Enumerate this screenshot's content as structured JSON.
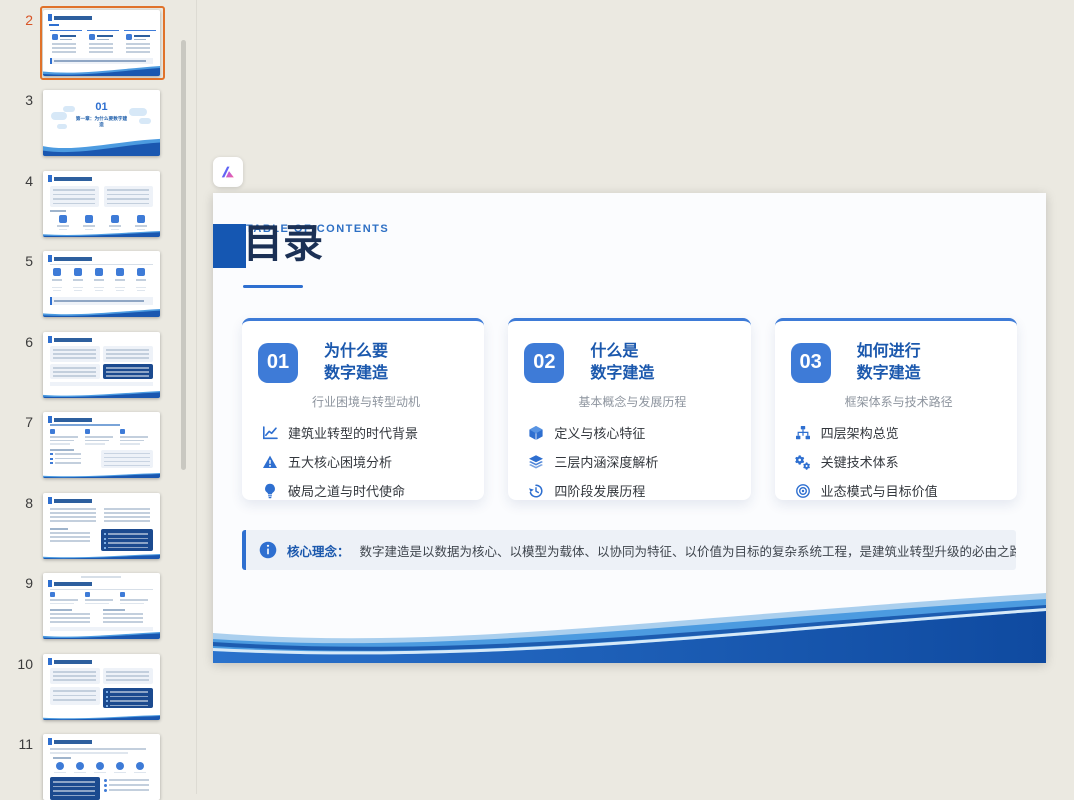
{
  "colors": {
    "accent_blue": "#2E6FD0",
    "badge_blue": "#3E7BD7",
    "title_navy": "#1B3055",
    "selection_orange": "#E0722A",
    "background": "#EBE9E1"
  },
  "sidebar": {
    "thumbnails": [
      {
        "number": "2",
        "selected": true,
        "layout": "toc"
      },
      {
        "number": "3",
        "selected": false,
        "layout": "cover",
        "cover_number": "01",
        "cover_title": "第一章：为什么要数字建造"
      },
      {
        "number": "4",
        "selected": false,
        "layout": "panels_icons"
      },
      {
        "number": "5",
        "selected": false,
        "layout": "columns_info"
      },
      {
        "number": "6",
        "selected": false,
        "layout": "grid_dark_br"
      },
      {
        "number": "7",
        "selected": false,
        "layout": "columns_table"
      },
      {
        "number": "8",
        "selected": false,
        "layout": "split_dark_br"
      },
      {
        "number": "9",
        "selected": false,
        "layout": "columns_lists"
      },
      {
        "number": "10",
        "selected": false,
        "layout": "blocks_dark_br"
      },
      {
        "number": "11",
        "selected": false,
        "layout": "icons_dark_bl"
      }
    ]
  },
  "slide": {
    "eyebrow": "TABLE OF CONTENTS",
    "title": "目录",
    "cards": [
      {
        "number": "01",
        "title_line1": "为什么要",
        "title_line2": "数字建造",
        "subtitle": "行业困境与转型动机",
        "items": [
          {
            "icon": "line-chart-icon",
            "text": "建筑业转型的时代背景"
          },
          {
            "icon": "alert-triangle-icon",
            "text": "五大核心困境分析"
          },
          {
            "icon": "lightbulb-icon",
            "text": "破局之道与时代使命"
          }
        ]
      },
      {
        "number": "02",
        "title_line1": "什么是",
        "title_line2": "数字建造",
        "subtitle": "基本概念与发展历程",
        "items": [
          {
            "icon": "cube-icon",
            "text": "定义与核心特征"
          },
          {
            "icon": "layers-icon",
            "text": "三层内涵深度解析"
          },
          {
            "icon": "history-icon",
            "text": "四阶段发展历程"
          }
        ]
      },
      {
        "number": "03",
        "title_line1": "如何进行",
        "title_line2": "数字建造",
        "subtitle": "框架体系与技术路径",
        "items": [
          {
            "icon": "sitemap-icon",
            "text": "四层架构总览"
          },
          {
            "icon": "gears-icon",
            "text": "关键技术体系"
          },
          {
            "icon": "target-icon",
            "text": "业态模式与目标价值"
          }
        ]
      }
    ],
    "note": {
      "label": "核心理念：",
      "text": "数字建造是以数据为核心、以模型为载体、以协同为特征、以价值为目标的复杂系统工程，是建筑业转型升级的必由之路。"
    }
  }
}
